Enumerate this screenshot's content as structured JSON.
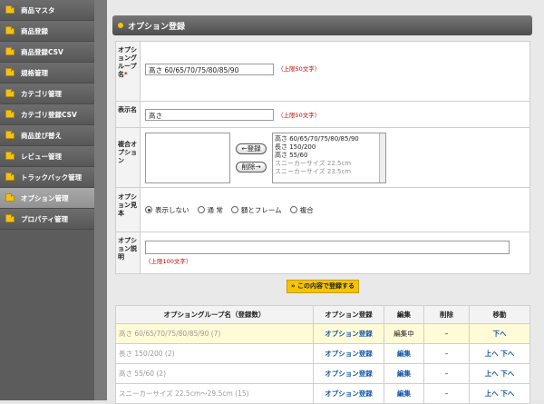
{
  "sidebar": {
    "items": [
      {
        "label": "商品マスタ"
      },
      {
        "label": "商品登録"
      },
      {
        "label": "商品登録CSV"
      },
      {
        "label": "規格管理"
      },
      {
        "label": "カテゴリ管理"
      },
      {
        "label": "カテゴリ登録CSV"
      },
      {
        "label": "商品並び替え"
      },
      {
        "label": "レビュー管理"
      },
      {
        "label": "トラックバック管理"
      },
      {
        "label": "オプション管理"
      },
      {
        "label": "プロパティ管理"
      }
    ]
  },
  "panel": {
    "title": "オプション登録"
  },
  "form": {
    "group_label": "オプショングループ名",
    "group_value": "高さ 60/65/70/75/80/85/90",
    "group_limit": "（上限50文字）",
    "display_label": "表示名",
    "display_value": "高さ",
    "display_limit": "（上限50文字）",
    "combo_label": "複合オプション",
    "register_btn": "←登録",
    "delete_btn": "削除→",
    "combo_options": [
      "高さ 60/65/70/75/80/85/90",
      "長さ 150/200",
      "高さ 55/60",
      "スニーカーサイズ 22.5cm",
      "スニーカーサイズ 23.5cm"
    ],
    "sample_label": "オプション見本",
    "radios": [
      {
        "label": "表示しない",
        "checked": true
      },
      {
        "label": "通 常",
        "checked": false
      },
      {
        "label": "額とフレーム",
        "checked": false
      },
      {
        "label": "複合",
        "checked": false
      }
    ],
    "desc_label": "オプション説明",
    "desc_limit": "（上限100文字）",
    "submit_label": "» この内容で登録する"
  },
  "table": {
    "headers": [
      "オプショングループ名（登録数）",
      "オプション登録",
      "編集",
      "削除",
      "移動"
    ],
    "rows": [
      {
        "name": "高さ 60/65/70/75/80/85/90 (7)",
        "reg": "オプション登録",
        "edit": "編集中",
        "del": "–",
        "move": "下へ"
      },
      {
        "name": "長さ 150/200 (2)",
        "reg": "オプション登録",
        "edit": "編集",
        "del": "–",
        "move": "上へ 下へ"
      },
      {
        "name": "高さ 55/60 (2)",
        "reg": "オプション登録",
        "edit": "編集",
        "del": "–",
        "move": "上へ 下へ"
      },
      {
        "name": "スニーカーサイズ 22.5cm～29.5cm (15)",
        "reg": "オプション登録",
        "edit": "編集",
        "del": "–",
        "move": "上へ 下へ"
      }
    ]
  }
}
